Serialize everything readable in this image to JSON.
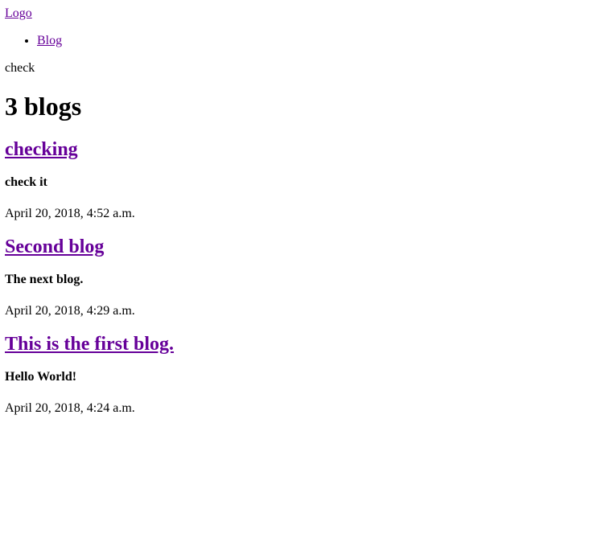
{
  "header": {
    "logo_label": "Logo",
    "nav": [
      {
        "label": "Blog"
      }
    ],
    "tagline": "check"
  },
  "main": {
    "count_heading": "3 blogs",
    "posts": [
      {
        "title": "checking",
        "summary": "check it",
        "date": "April 20, 2018, 4:52 a.m."
      },
      {
        "title": "Second blog",
        "summary": "The next blog.",
        "date": "April 20, 2018, 4:29 a.m."
      },
      {
        "title": "This is the first blog.",
        "summary": "Hello World!",
        "date": "April 20, 2018, 4:24 a.m."
      }
    ]
  },
  "colors": {
    "link": "#660099",
    "text": "#000000",
    "background": "#ffffff"
  }
}
